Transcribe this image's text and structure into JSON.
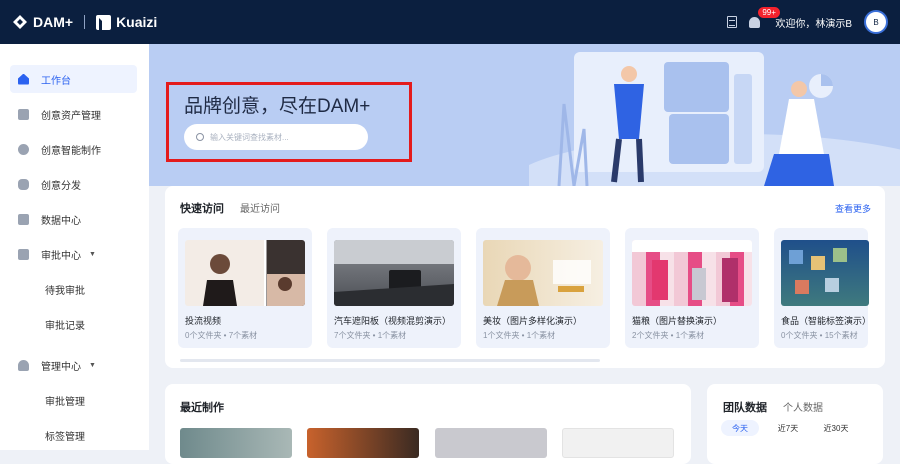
{
  "topbar": {
    "brand": "DAM+",
    "partner": "Kuaizi",
    "notification_count": "99+",
    "greeting": "欢迎你，林演示B",
    "avatar_text": "B"
  },
  "sidebar": {
    "items": [
      {
        "label": "工作台",
        "icon": "home-icon"
      },
      {
        "label": "创意资产管理",
        "icon": "layers-icon"
      },
      {
        "label": "创意智能制作",
        "icon": "bulb-icon"
      },
      {
        "label": "创意分发",
        "icon": "share-icon"
      },
      {
        "label": "数据中心",
        "icon": "database-icon"
      },
      {
        "label": "审批中心",
        "icon": "approval-icon"
      },
      {
        "label": "待我审批"
      },
      {
        "label": "审批记录"
      },
      {
        "label": "管理中心",
        "icon": "user-icon"
      },
      {
        "label": "审批管理"
      },
      {
        "label": "标签管理"
      }
    ]
  },
  "hero": {
    "title": "品牌创意，尽在DAM+",
    "search_placeholder": "输入关键词查找素材..."
  },
  "quick": {
    "tab_active": "快速访问",
    "tab_other": "最近访问",
    "more": "查看更多",
    "cards": [
      {
        "title": "投流视频",
        "meta": "0个文件夹 • 7个素材"
      },
      {
        "title": "汽车遮阳板（视频混剪演示）",
        "meta": "7个文件夹 • 1个素材"
      },
      {
        "title": "美妆（图片多样化演示）",
        "meta": "1个文件夹 • 1个素材"
      },
      {
        "title": "猫粮（图片替换演示）",
        "meta": "2个文件夹 • 1个素材"
      },
      {
        "title": "食品（智能标签演示）",
        "meta": "0个文件夹 • 15个素材"
      }
    ]
  },
  "recent": {
    "title": "最近制作"
  },
  "team": {
    "tab_active": "团队数据",
    "tab_other": "个人数据",
    "periods": [
      "今天",
      "近7天",
      "近30天"
    ]
  },
  "colors": {
    "topbar": "#0b1f3f",
    "accent": "#2b62f0",
    "hero": "#b9cdf3",
    "highlight": "#e41b1b"
  }
}
